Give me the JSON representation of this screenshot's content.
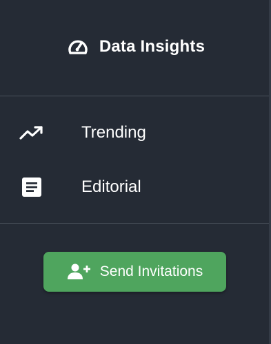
{
  "brand": {
    "title": "Data Insights",
    "icon": "speedometer-icon"
  },
  "nav": {
    "items": [
      {
        "label": "Trending",
        "icon": "trending-up-icon"
      },
      {
        "label": "Editorial",
        "icon": "article-icon"
      }
    ]
  },
  "actions": {
    "send_invitations_label": "Send Invitations",
    "send_invitations_icon": "add-user-icon"
  },
  "colors": {
    "background": "#252b35",
    "divider": "#4a515b",
    "text": "#ffffff",
    "accent_button": "#4fa55e"
  }
}
